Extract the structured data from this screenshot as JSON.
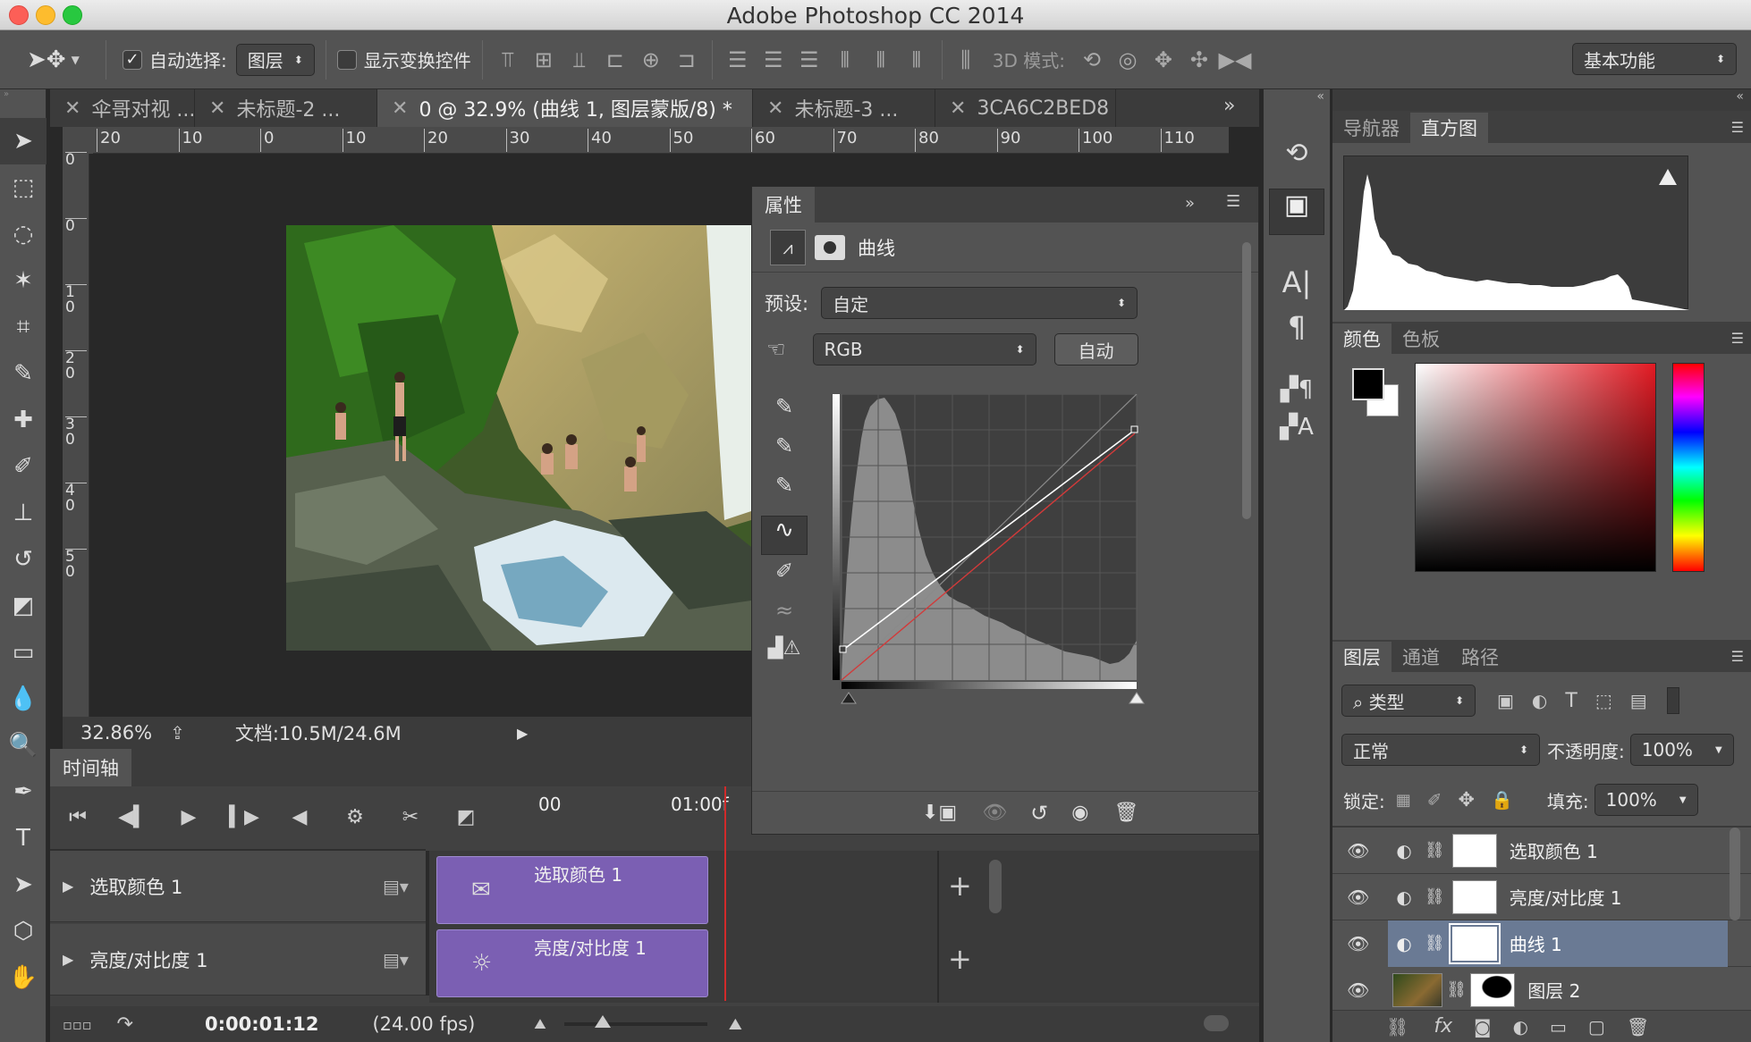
{
  "app": {
    "title": "Adobe Photoshop CC 2014",
    "colors": {
      "accent_purple": "#7b5fb3",
      "playhead": "#d12a2a",
      "selected_layer": "#6a7a94"
    }
  },
  "options_bar": {
    "auto_select_label": "自动选择:",
    "auto_select_checked": true,
    "auto_select_target": "图层",
    "show_transform_label": "显示变换控件",
    "show_transform_checked": false,
    "mode3d_label": "3D 模式:",
    "workspace": "基本功能"
  },
  "tabs": [
    {
      "label": "伞哥对视 ...",
      "active": false
    },
    {
      "label": "未标题-2 ...",
      "active": false
    },
    {
      "label": "0 @ 32.9% (曲线 1, 图层蒙版/8) *",
      "active": true
    },
    {
      "label": "未标题-3 ...",
      "active": false
    },
    {
      "label": "3CA6C2BED8",
      "active": false
    }
  ],
  "ruler": {
    "h_ticks": [
      "20",
      "10",
      "0",
      "10",
      "20",
      "30",
      "40",
      "50",
      "60",
      "70",
      "80",
      "90",
      "100",
      "110"
    ],
    "v_ticks": [
      "0",
      "0",
      "1\n0",
      "2\n0",
      "3\n0",
      "4\n0",
      "5\n0"
    ]
  },
  "status": {
    "zoom": "32.86%",
    "doc": "文档:10.5M/24.6M"
  },
  "properties": {
    "panel_title": "属性",
    "adjustment_name": "曲线",
    "preset_label": "预设:",
    "preset_value": "自定",
    "channel": "RGB",
    "auto_button": "自动"
  },
  "timeline": {
    "title": "时间轴",
    "time_marks": [
      "00",
      "01:00f"
    ],
    "tracks": [
      {
        "name": "选取颜色 1",
        "clip_label": "选取颜色 1"
      },
      {
        "name": "亮度/对比度 1",
        "clip_label": "亮度/对比度 1"
      }
    ],
    "current_time": "0:00:01:12",
    "fps": "(24.00 fps)"
  },
  "navigator_tabs": [
    {
      "label": "导航器",
      "active": false
    },
    {
      "label": "直方图",
      "active": true
    }
  ],
  "color_tabs": [
    {
      "label": "颜色",
      "active": true
    },
    {
      "label": "色板",
      "active": false
    }
  ],
  "layers_panel": {
    "tabs": [
      {
        "label": "图层",
        "active": true
      },
      {
        "label": "通道",
        "active": false
      },
      {
        "label": "路径",
        "active": false
      }
    ],
    "filter_kind": "类型",
    "blend_mode": "正常",
    "opacity_label": "不透明度:",
    "opacity_value": "100%",
    "lock_label": "锁定:",
    "fill_label": "填充:",
    "fill_value": "100%",
    "layers": [
      {
        "name": "选取颜色 1",
        "selected": false
      },
      {
        "name": "亮度/对比度 1",
        "selected": false
      },
      {
        "name": "曲线 1",
        "selected": true
      },
      {
        "name": "图层 2",
        "selected": false
      }
    ]
  }
}
